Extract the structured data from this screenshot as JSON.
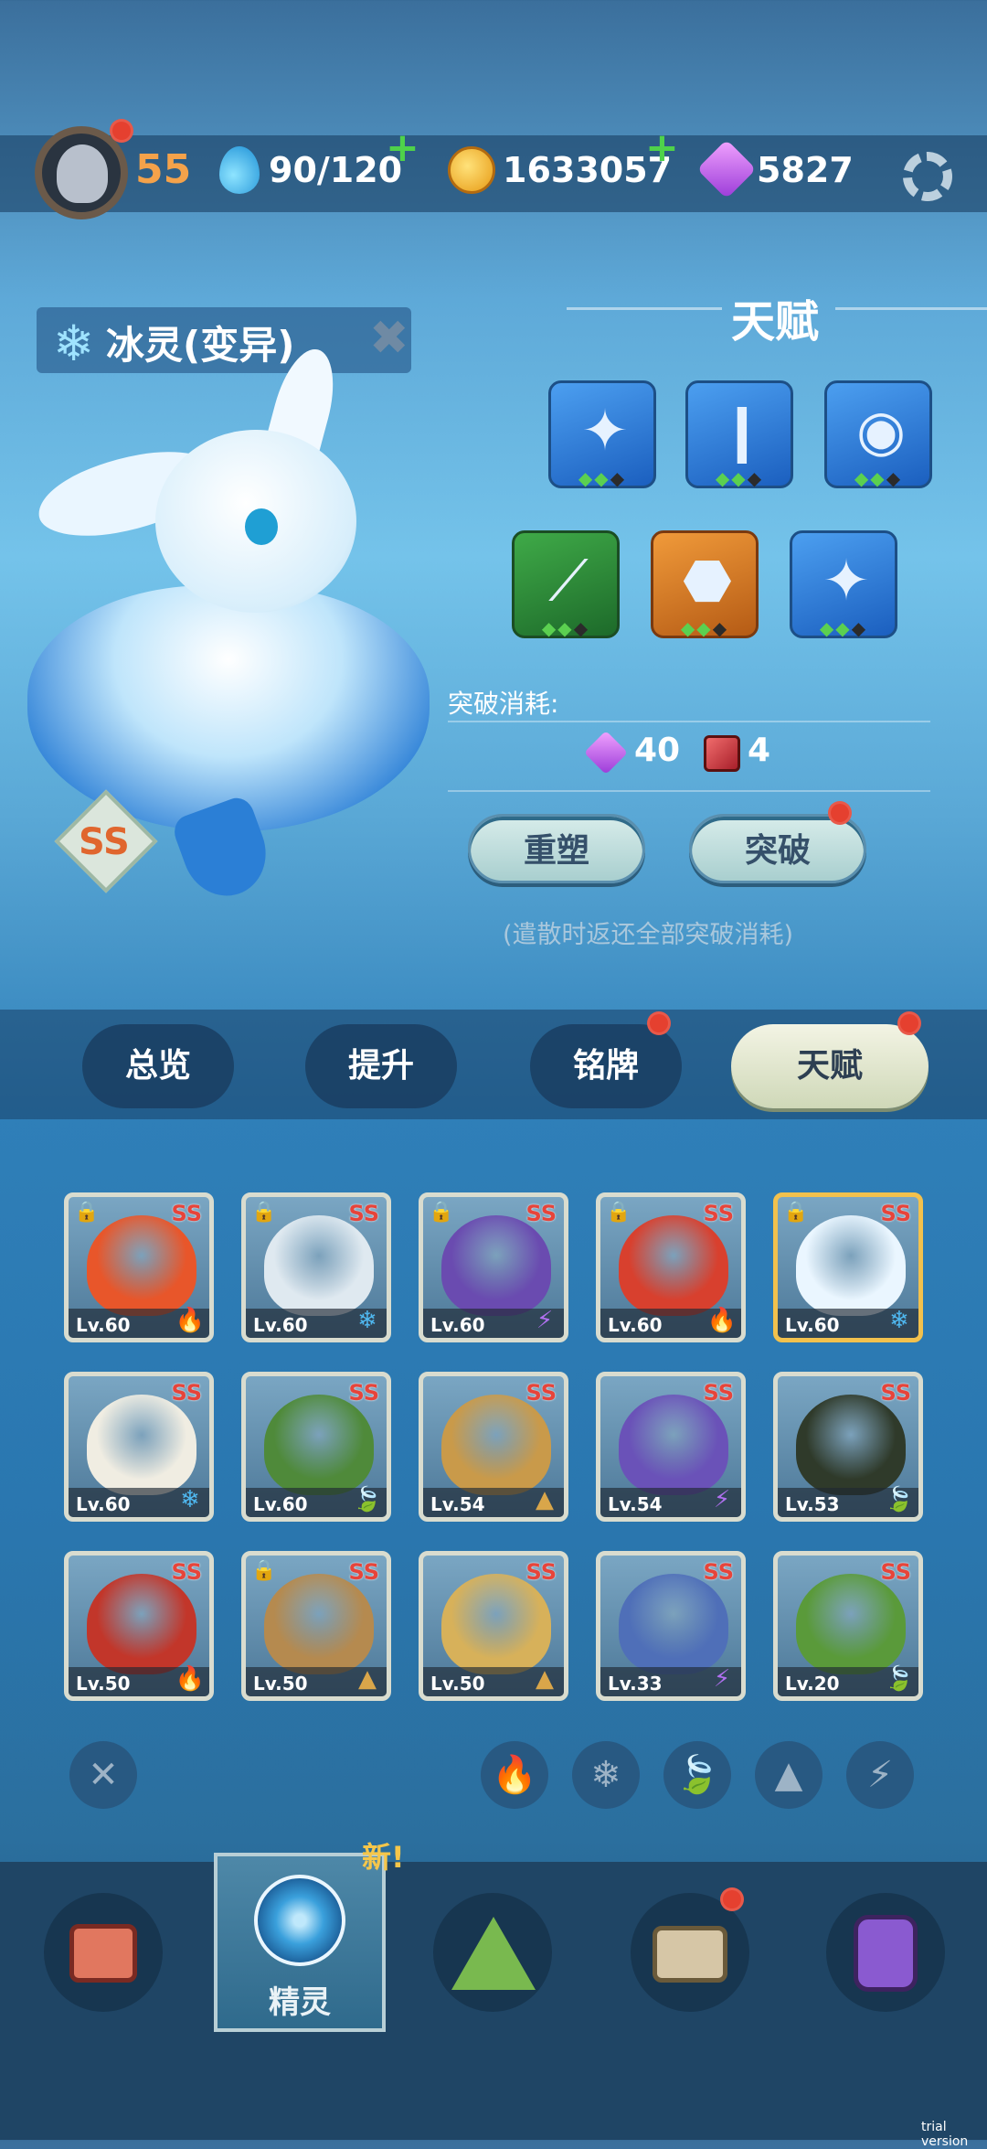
{
  "top_bar": {
    "player_level": "55",
    "stamina": "90/120",
    "coins": "1633057",
    "gems": "5827",
    "plus_symbol": "+",
    "icons": [
      "avatar",
      "water-drop-icon",
      "coin-icon",
      "gem-icon",
      "gear-icon"
    ]
  },
  "pet": {
    "name": "冰灵(变异)",
    "rank": "SS",
    "element_icon": "snowflake-icon"
  },
  "talent_panel": {
    "title": "天赋",
    "skills": [
      {
        "icon": "sparkle-icon",
        "color": "blue",
        "pips": 3,
        "lit": 2
      },
      {
        "icon": "claw-icon",
        "color": "blue",
        "pips": 3,
        "lit": 2
      },
      {
        "icon": "eye-icon",
        "color": "blue",
        "pips": 3,
        "lit": 2
      },
      {
        "icon": "slash-icon",
        "color": "green",
        "pips": 3,
        "lit": 2
      },
      {
        "icon": "ruby-icon",
        "color": "orange",
        "pips": 3,
        "lit": 2
      },
      {
        "icon": "sparkle-icon",
        "color": "blue",
        "pips": 3,
        "lit": 2
      }
    ],
    "breakthrough_cost_label": "突破消耗:",
    "cost_gems": "40",
    "cost_books": "4",
    "reshape_label": "重塑",
    "breakthrough_label": "突破",
    "note": "(遣散时返还全部突破消耗)"
  },
  "tabs": {
    "overview": "总览",
    "upgrade": "提升",
    "badge": "铭牌",
    "talent": "天赋"
  },
  "pet_cards": [
    {
      "level": "Lv.60",
      "rank": "SS",
      "element": "fire",
      "locked": true,
      "art_color": "#e8562a"
    },
    {
      "level": "Lv.60",
      "rank": "SS",
      "element": "ice",
      "locked": true,
      "art_color": "#dfe9f0"
    },
    {
      "level": "Lv.60",
      "rank": "SS",
      "element": "thunder",
      "locked": true,
      "art_color": "#6a4bb0"
    },
    {
      "level": "Lv.60",
      "rank": "SS",
      "element": "fire",
      "locked": true,
      "art_color": "#d8402e"
    },
    {
      "level": "Lv.60",
      "rank": "SS",
      "element": "ice",
      "locked": true,
      "art_color": "#eaf6ff",
      "selected": true
    },
    {
      "level": "Lv.60",
      "rank": "SS",
      "element": "ice",
      "locked": false,
      "art_color": "#f0ede2"
    },
    {
      "level": "Lv.60",
      "rank": "SS",
      "element": "grass",
      "locked": false,
      "art_color": "#4f8a3a"
    },
    {
      "level": "Lv.54",
      "rank": "SS",
      "element": "earth",
      "locked": false,
      "art_color": "#c99a4a"
    },
    {
      "level": "Lv.54",
      "rank": "SS",
      "element": "thunder",
      "locked": false,
      "art_color": "#6a52b8"
    },
    {
      "level": "Lv.53",
      "rank": "SS",
      "element": "grass",
      "locked": false,
      "art_color": "#2f3a2a"
    },
    {
      "level": "Lv.50",
      "rank": "SS",
      "element": "fire",
      "locked": false,
      "art_color": "#c2362a"
    },
    {
      "level": "Lv.50",
      "rank": "SS",
      "element": "earth",
      "locked": true,
      "art_color": "#b58a4f"
    },
    {
      "level": "Lv.50",
      "rank": "SS",
      "element": "earth",
      "locked": false,
      "art_color": "#d7b15a"
    },
    {
      "level": "Lv.33",
      "rank": "SS",
      "element": "thunder",
      "locked": false,
      "art_color": "#4f6fb8"
    },
    {
      "level": "Lv.20",
      "rank": "SS",
      "element": "grass",
      "locked": false,
      "art_color": "#5a9a3a"
    }
  ],
  "filters": {
    "clear_icon": "close-icon",
    "elements": [
      "fire-icon",
      "ice-icon",
      "grass-icon",
      "earth-icon",
      "thunder-icon"
    ]
  },
  "bottom_nav": {
    "active_label": "精灵",
    "new_tag": "新!",
    "items": [
      "screen-icon",
      "pet-icon",
      "mountain-icon",
      "chest-icon",
      "map-pin-icon"
    ]
  },
  "watermark": "trial version",
  "colors": {
    "accent_red": "#e5402f",
    "level_orange": "#f4a24a",
    "rank_red": "#e7443a"
  }
}
